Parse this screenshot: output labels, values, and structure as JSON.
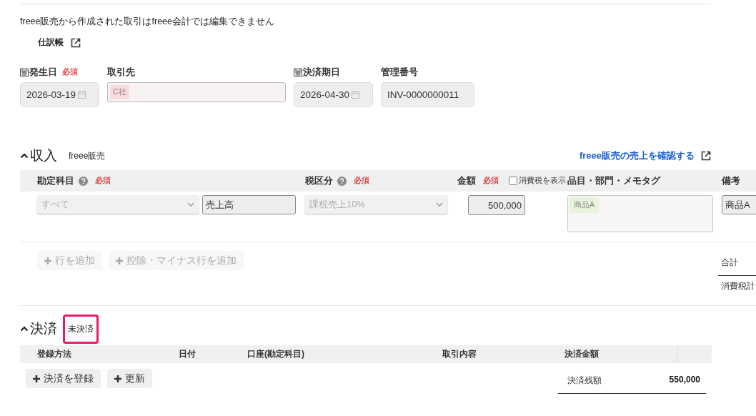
{
  "notice": "freee販売から作成された取引はfreee会計では編集できません",
  "journal_link": {
    "label": "仕訳帳"
  },
  "header_fields": [
    {
      "kind": "date",
      "label": "発生日",
      "required_label": "必須",
      "value": "2026-03-19"
    },
    {
      "kind": "partner",
      "label": "取引先",
      "tag": "C社"
    },
    {
      "kind": "date",
      "label": "決済期日",
      "value": "2026-04-30"
    },
    {
      "kind": "text",
      "label": "管理番号",
      "value": "INV-0000000011"
    }
  ],
  "income": {
    "title": "収入",
    "expanded": true,
    "source": "freee販売",
    "link": "freee販売の売上を確認する",
    "columns": [
      {
        "label": "勘定科目",
        "help": true,
        "required_label": "必須"
      },
      {
        "label": "税区分",
        "help": true,
        "required_label": "必須"
      },
      {
        "label": "金額",
        "help": false,
        "required_label": "必須"
      },
      {
        "label": "品目・部門・メモタグ",
        "help": false
      },
      {
        "label": "備考",
        "help": false
      }
    ],
    "show_tax": {
      "label": "消費税を表示",
      "checked": false
    },
    "rows": [
      {
        "account_filter": "すべて",
        "account": "売上高",
        "tax": "課税売上10%",
        "amount": "500,000",
        "tags": [
          "商品A"
        ],
        "note": "商品A"
      }
    ],
    "buttons": [
      {
        "label": "行を追加",
        "disabled": true
      },
      {
        "label": "控除・マイナス行を追加",
        "disabled": true
      }
    ],
    "totals": [
      "合計",
      "消費税計"
    ]
  },
  "payment": {
    "title": "決済",
    "expanded": true,
    "status": "未決済",
    "columns": [
      "登録方法",
      "日付",
      "口座(勘定科目)",
      "取引内容",
      "決済金額"
    ],
    "buttons": [
      {
        "label": "決済を登録",
        "disabled": false
      },
      {
        "label": "更新",
        "disabled": false
      }
    ],
    "balance": {
      "label": "決済残額",
      "value": "550,000"
    }
  }
}
